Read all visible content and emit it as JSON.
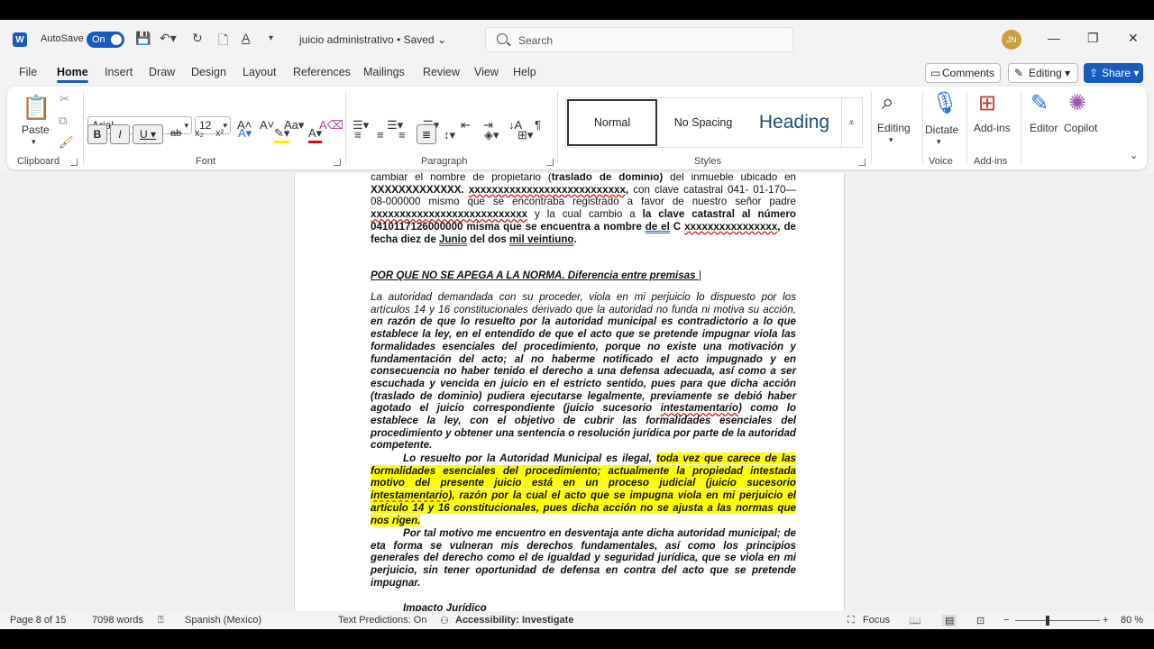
{
  "title_bar": {
    "autosave_label": "AutoSave",
    "autosave_state": "On",
    "doc_title": "juicio administrativo • Saved",
    "search_placeholder": "Search",
    "avatar_initials": "JN"
  },
  "menu": {
    "tabs": [
      "File",
      "Home",
      "Insert",
      "Draw",
      "Design",
      "Layout",
      "References",
      "Mailings",
      "Review",
      "View",
      "Help"
    ],
    "active": "Home",
    "comments": "Comments",
    "editing": "Editing",
    "share": "Share"
  },
  "ribbon": {
    "clipboard": {
      "paste": "Paste",
      "label": "Clipboard"
    },
    "font": {
      "name": "Arial",
      "size": "12",
      "label": "Font"
    },
    "paragraph": {
      "label": "Paragraph"
    },
    "styles": {
      "items": [
        "Normal",
        "No Spacing",
        "Heading"
      ],
      "label": "Styles"
    },
    "editing_btn": "Editing",
    "dictate_btn": "Dictate",
    "voice_label": "Voice",
    "addins_btn": "Add-ins",
    "addins_label": "Add-ins",
    "editor_btn": "Editor",
    "copilot_btn": "Copilot"
  },
  "document": {
    "para1_part1": "cambiar el nombre de propietario (",
    "para1_bold1": "traslado de dominio)",
    "para1_part2": " del inmueble ubicado en ",
    "para1_bold2": "XXXXXXXXXXXXX.",
    "para1_x1": "xxxxxxxxxxxxxxxxxxxxxxxxxxx,",
    "para1_part3": " con clave catastral 041- 01-170—08-000000 mismo que se encontraba registrado a favor de nuestro señor padre ",
    "para1_x2": "xxxxxxxxxxxxxxxxxxxxxxxxxxx",
    "para1_part4": " y la cual cambio a ",
    "para1_bold3": "la clave catastral al número 0410117126000000 misma que se encuentra a nombre ",
    "para1_de_el": "de el",
    "para1_bold4": " C ",
    "para1_x3": "xxxxxxxxxxxxxxxx",
    "para1_bold5": ", de fecha diez de ",
    "para1_junio": "Junio",
    "para1_bold6": " del dos ",
    "para1_mil": "mil veintiuno",
    "para1_end": ".",
    "heading": "POR QUE NO SE APEGA A LA NORMA. Diferencia entre premisas",
    "para2_italic": "La autoridad demandada con su proceder, viola en mi perjuicio lo dispuesto por los artículos 14 y 16 constitucionales derivado que la autoridad no funda ni motiva su acción,",
    "para2_bi": " en razón de que lo resuelto por la autoridad municipal es contradictorio a lo que establece la ley, en el entendido de que el acto que se pretende impugnar viola las formalidades esenciales del procedimiento, porque no existe una motivación y fundamentación del acto; al no haberme notificado el acto impugnado y en consecuencia no haber tenido el derecho a una defensa adecuada, así como a ser escuchada y vencida en juicio  en el estricto sentido, pues para que dicha acción (traslado de dominio) pudiera ejecutarse legalmente, previamente se debió haber agotado el juicio correspondiente (juicio sucesorio ",
    "para2_intest": "intestamentario",
    "para2_bi2": ") como lo establece la ley,  con el objetivo de cubrir las formalidades esenciales del procedimiento y obtener una sentencia o resolución jurídica por parte de la autoridad competente.",
    "para3_plain": "Lo resuelto por la Autoridad Municipal es ilegal, ",
    "para3_hl": "toda vez que carece de las formalidades esenciales del procedimiento; actualmente la propiedad intestada motivo del presente juicio está en un proceso judicial (juicio sucesorio ",
    "para3_hl_intest": "intestamentario",
    "para3_hl2": "), razón por la cual el acto que se impugna viola en mi perjuicio el artículo 14 y 16 constitucionales, pues dicha acción no se ajusta a las normas que nos rigen.",
    "para4": "Por tal motivo me encuentro en desventaja ante dicha autoridad municipal; de eta forma se vulneran mis derechos fundamentales, así como los principios generales del derecho como el de igualdad y seguridad jurídica, que se viola en mi perjuicio, sin tener oportunidad de defensa en contra del acto que se pretende impugnar.",
    "para5": "Impacto  Jurídico"
  },
  "status": {
    "page": "Page 8 of 15",
    "words": "7098 words",
    "language": "Spanish (Mexico)",
    "predictions": "Text Predictions: On",
    "accessibility": "Accessibility: Investigate",
    "focus": "Focus",
    "zoom": "80 %"
  }
}
